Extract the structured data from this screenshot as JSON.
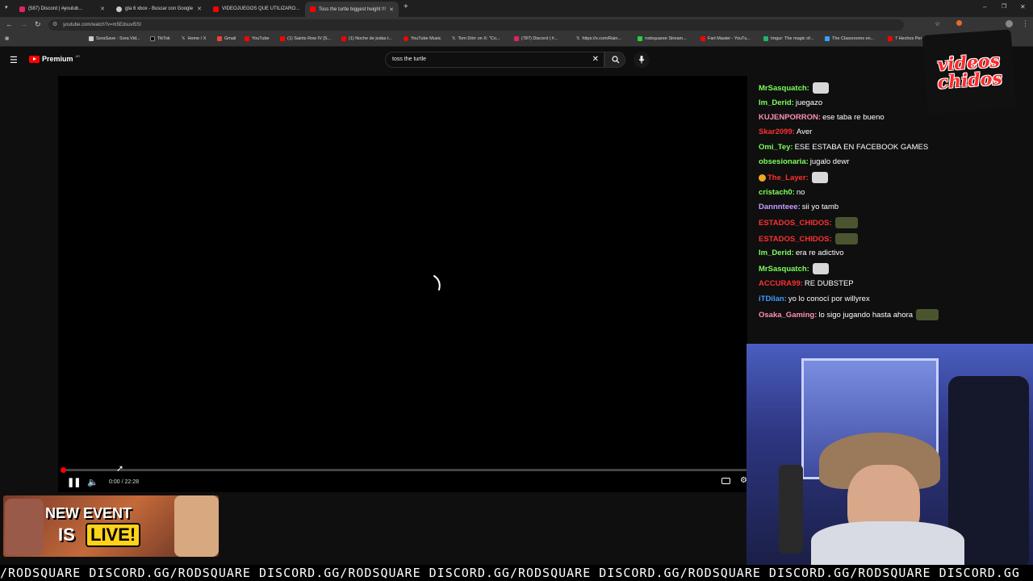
{
  "browser": {
    "tabs": [
      {
        "label": "(587) Discord | #̶youtub...",
        "color": "#e0245e"
      },
      {
        "label": "gta 6 xbox - Buscar con Google",
        "color": "#cccccc"
      },
      {
        "label": "VIDEOJUEGOS QUE UTILIZARO...",
        "color": "#ff0000"
      },
      {
        "label": "Toss the turtle biggest height !!!",
        "color": "#ff0000"
      }
    ],
    "url": "youtube.com/watch?v=m5Edsuvl5SI",
    "bookmarks": [
      "SoraSave - Sora Vid...",
      "TikTok",
      "Home / X",
      "Gmail",
      "YouTube",
      "(1) Saints Row IV [S...",
      "(1) Noche de jodas t...",
      "YouTube Music",
      "Tom Dörr on X: \"Co...",
      "(787) Discord | #...",
      "https://x.com/Rain...",
      "rodsquaree Stream...",
      "Fart Master - YouTu...",
      "Imgur: The magic of...",
      "The Classrooms en...",
      "7 Hechos Per"
    ]
  },
  "youtube": {
    "logo": "Premium",
    "region": "AR",
    "search_value": "toss the turtle"
  },
  "player": {
    "time": "0:00 / 22:28",
    "progress": 0.0
  },
  "chat": {
    "messages": [
      {
        "user": "MrSasquatch:",
        "text": "",
        "color": "#7cff5a",
        "emote": "white"
      },
      {
        "user": "Im_Derid:",
        "text": "juegazo",
        "color": "#7cff5a",
        "emote": ""
      },
      {
        "user": "KUJENPORRON:",
        "text": "ese taba re bueno",
        "color": "#ff8fb0",
        "emote": ""
      },
      {
        "user": "Skar2099:",
        "text": "Aver",
        "color": "#ff3030",
        "emote": ""
      },
      {
        "user": "Omi_Tey:",
        "text": "ESE ESTABA EN FACEBOOK GAMES",
        "color": "#7cff5a",
        "emote": ""
      },
      {
        "user": "obsesionaria:",
        "text": "jugalo dewr",
        "color": "#7cff5a",
        "emote": ""
      },
      {
        "user": "The_Layer:",
        "text": "",
        "color": "#ff3030",
        "emote": "white"
      },
      {
        "user": "cristach0:",
        "text": "no",
        "color": "#7cff5a",
        "emote": ""
      },
      {
        "user": "Dannnteee:",
        "text": "sii yo tamb",
        "color": "#c89cff",
        "emote": ""
      },
      {
        "user": "ESTADOS_CHIDOS:",
        "text": "",
        "color": "#ff3030",
        "emote": "dark"
      },
      {
        "user": "ESTADOS_CHIDOS:",
        "text": "",
        "color": "#ff3030",
        "emote": "dark"
      },
      {
        "user": "Im_Derid:",
        "text": "era re adictivo",
        "color": "#7cff5a",
        "emote": ""
      },
      {
        "user": "MrSasquatch:",
        "text": "",
        "color": "#7cff5a",
        "emote": "white"
      },
      {
        "user": "ACCURA99:",
        "text": "RE DUBSTEP",
        "color": "#ff3030",
        "emote": ""
      },
      {
        "user": "iTDilan:",
        "text": "yo lo conocí por willyrex",
        "color": "#3aa0ff",
        "emote": ""
      },
      {
        "user": "Osaka_Gaming:",
        "text": "lo sigo jugando hasta ahora",
        "color": "#ff8fb0",
        "emote": "dark"
      }
    ]
  },
  "overlay": {
    "logo_text_1": "videos",
    "logo_text_2": "chidos",
    "banner_line1": "NEW EVENT",
    "banner_line2a": "IS",
    "banner_line2b": "LIVE!",
    "ticker": "/RODSQUARE DISCORD.GG/RODSQUARE DISCORD.GG/RODSQUARE DISCORD.GG/RODSQUARE DISCORD.GG/RODSQUARE DISCORD.GG/RODSQUARE DISCORD.GG"
  },
  "colors": {
    "accent_red": "#ff0000",
    "bg": "#0f0f0f"
  }
}
